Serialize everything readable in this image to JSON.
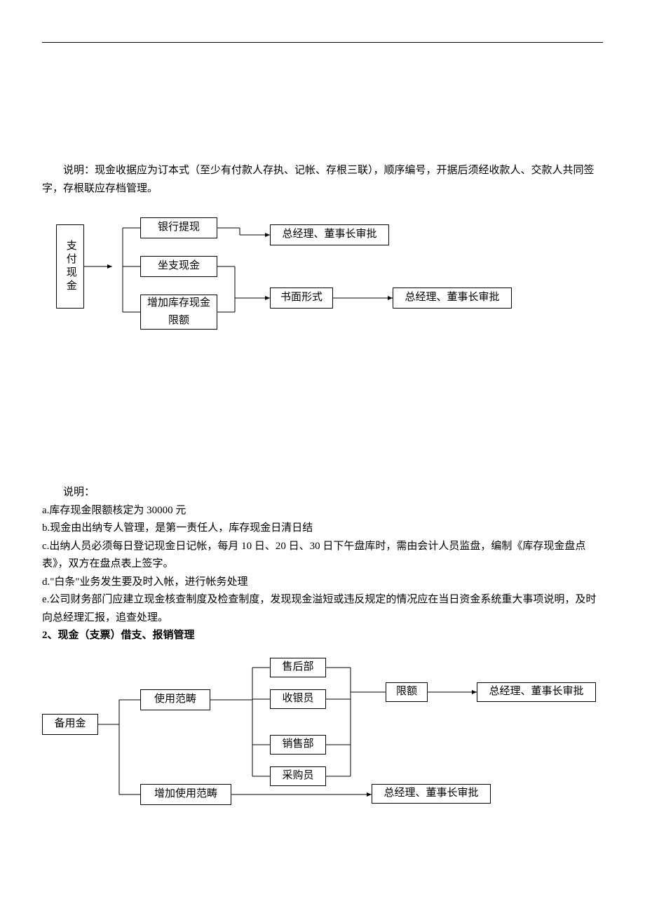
{
  "intro1": "说明：现金收据应为订本式（至少有付款人存执、记帐、存根三联），顺序编号，开据后须经收款人、交款人共同签字，存根联应存档管理。",
  "d1": {
    "root": "支付现金",
    "a": "银行提现",
    "b": "坐支现金",
    "c": "增加库存现金限额",
    "r1": "总经理、董事长审批",
    "m": "书面形式",
    "r2": "总经理、董事长审批"
  },
  "notes_title": "说明：",
  "note_a": "a.库存现金限额核定为 30000 元",
  "note_b": "b.现金由出纳专人管理，是第一责任人，库存现金日清日结",
  "note_c": "c.出纳人员必须每日登记现金日记帐，每月 10 日、20 日、30 日下午盘库时，需由会计人员监盘，编制《库存现金盘点表》，双方在盘点表上签字。",
  "note_d": "d.\"白条\"业务发生要及时入帐，进行帐务处理",
  "note_e": "e.公司财务部门应建立现金核查制度及检查制度，发现现金溢短或违反规定的情况应在当日资金系统重大事项说明，及时向总经理汇报，追查处理。",
  "section2": "2、现金（支票）借支、报销管理",
  "d2": {
    "root": "备用金",
    "scope": "使用范畴",
    "scope_add": "增加使用范畴",
    "p1": "售后部",
    "p2": "收银员",
    "p3": "销售部",
    "p4": "采购员",
    "limit": "限额",
    "appr1": "总经理、董事长审批",
    "appr2": "总经理、董事长审批"
  }
}
